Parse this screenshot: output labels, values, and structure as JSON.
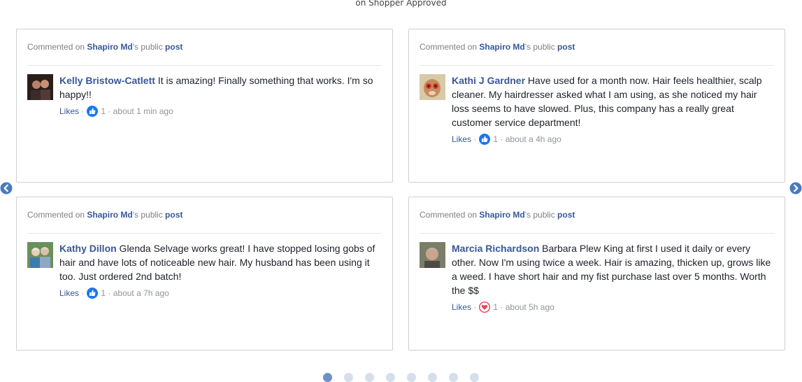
{
  "caption": "on Shopper Approved",
  "cards": [
    {
      "head": {
        "prefix": "Commented on ",
        "page": "Shapiro Md",
        "suffix": "'s public ",
        "post": "post"
      },
      "author": "Kelly Bristow-Catlett",
      "text": " It is amazing! Finally something that works. I'm so happy!!",
      "likes_label": "Likes",
      "reaction": "like",
      "count": "1",
      "time": "about 1 min ago"
    },
    {
      "head": {
        "prefix": "Commented on ",
        "page": "Shapiro Md",
        "suffix": "'s public ",
        "post": "post"
      },
      "author": "Kathi J Gardner",
      "text": " Have used for a month now. Hair feels healthier, scalp cleaner. My hairdresser asked what I am using, as she noticed my hair loss seems to have slowed. Plus, this company has a really great customer service department!",
      "likes_label": "Likes",
      "reaction": "like",
      "count": "1",
      "time": "about a 4h ago"
    },
    {
      "head": {
        "prefix": "Commented on ",
        "page": "Shapiro Md",
        "suffix": "'s public ",
        "post": "post"
      },
      "author": "Kathy Dillon",
      "text": " Glenda Selvage works great! I have stopped losing gobs of hair and have lots of noticeable new hair. My husband has been using it too. Just ordered 2nd batch!",
      "likes_label": "Likes",
      "reaction": "like",
      "count": "1",
      "time": "about a 7h ago"
    },
    {
      "head": {
        "prefix": "Commented on ",
        "page": "Shapiro Md",
        "suffix": "'s public ",
        "post": "post"
      },
      "author": "Marcia Richardson",
      "text": " Barbara Plew King at first I used it daily or every other. Now I'm using twice a week. Hair is amazing, thicken up, grows like a weed. I have short hair and my fist purchase last over 5 months. Worth the $$",
      "likes_label": "Likes",
      "reaction": "love",
      "count": "1",
      "time": "about 5h ago"
    }
  ],
  "nav": {
    "prev": "chevron-left-icon",
    "next": "chevron-right-icon"
  },
  "pagination": {
    "total": 8,
    "active": 1
  },
  "colors": {
    "link": "#365899",
    "like": "#1877f2",
    "love": "#f33e58",
    "dot": "#d5dfec",
    "dot_active": "#6f8fc7"
  }
}
